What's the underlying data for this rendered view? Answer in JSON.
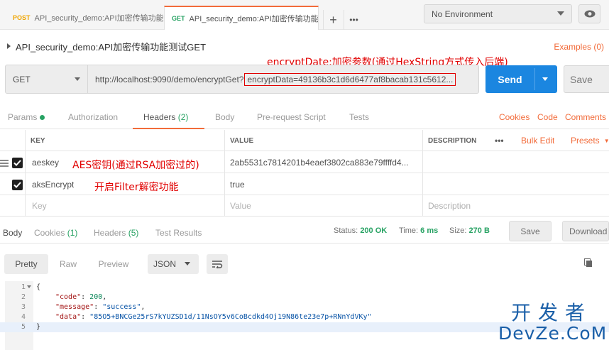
{
  "tabs": [
    {
      "method": "POST",
      "label": "API_security_demo:API加密传输功能测"
    },
    {
      "method": "GET",
      "label": "API_security_demo:API加密传输功能测"
    }
  ],
  "environment": "No Environment",
  "request_title": "API_security_demo:API加密传输功能测试GET",
  "examples_label": "Examples (0)",
  "annotations": {
    "encrypt": "encryptDate:加密参数(通过HexString方式传入后端)",
    "aeskey": "AES密钥(通过RSA加密过的)",
    "filter": "开启Filter解密功能"
  },
  "url": {
    "method": "GET",
    "base": "http://localhost:9090/demo/encryptGet?",
    "param": "encryptData=49136b3c1d6d6477af8bacab131c5612..."
  },
  "send_label": "Send",
  "save_label": "Save",
  "request_tabs": [
    {
      "label": "Params",
      "count": ""
    },
    {
      "label": "Authorization",
      "count": ""
    },
    {
      "label": "Headers",
      "count": "(2)"
    },
    {
      "label": "Body",
      "count": ""
    },
    {
      "label": "Pre-request Script",
      "count": ""
    },
    {
      "label": "Tests",
      "count": ""
    }
  ],
  "request_links": {
    "cookies": "Cookies",
    "code": "Code",
    "comments": "Comments"
  },
  "headers_table": {
    "columns": {
      "key": "KEY",
      "value": "VALUE",
      "description": "DESCRIPTION"
    },
    "more": "•••",
    "bulk_edit": "Bulk Edit",
    "presets": "Presets",
    "rows": [
      {
        "key": "aeskey",
        "value": "2ab5531c7814201b4eaef3802ca883e79ffffd4..."
      },
      {
        "key": "aksEncrypt",
        "value": "true"
      }
    ],
    "placeholders": {
      "key": "Key",
      "value": "Value",
      "description": "Description"
    }
  },
  "response_tabs": [
    {
      "label": "Body",
      "count": ""
    },
    {
      "label": "Cookies",
      "count": "(1)"
    },
    {
      "label": "Headers",
      "count": "(5)"
    },
    {
      "label": "Test Results",
      "count": ""
    }
  ],
  "response_status": {
    "status_label": "Status:",
    "status": "200 OK",
    "time_label": "Time:",
    "time": "6 ms",
    "size_label": "Size:",
    "size": "270 B"
  },
  "response_buttons": {
    "save": "Save",
    "download": "Download"
  },
  "format_buttons": {
    "pretty": "Pretty",
    "raw": "Raw",
    "preview": "Preview",
    "type": "JSON"
  },
  "response_body": {
    "line_numbers": [
      "1",
      "2",
      "3",
      "4",
      "5"
    ],
    "open_brace": "{",
    "close_brace": "}",
    "fields": [
      {
        "key": "\"code\"",
        "value": "200"
      },
      {
        "key": "\"message\"",
        "value": "\"success\""
      },
      {
        "key": "\"data\"",
        "value": "\"85O5+BNCGe25rS7kYUZSD1d/11NsOY5v6CoBcdkd4Oj19N86te23e7p+RNnYdVKy\""
      }
    ]
  },
  "watermark": {
    "line1": "开发者",
    "line2": "DevZe.CoM"
  },
  "colors": {
    "accent": "#f26b3a",
    "send": "#1b86e0",
    "success": "#27a263",
    "annotation": "#e10000"
  }
}
